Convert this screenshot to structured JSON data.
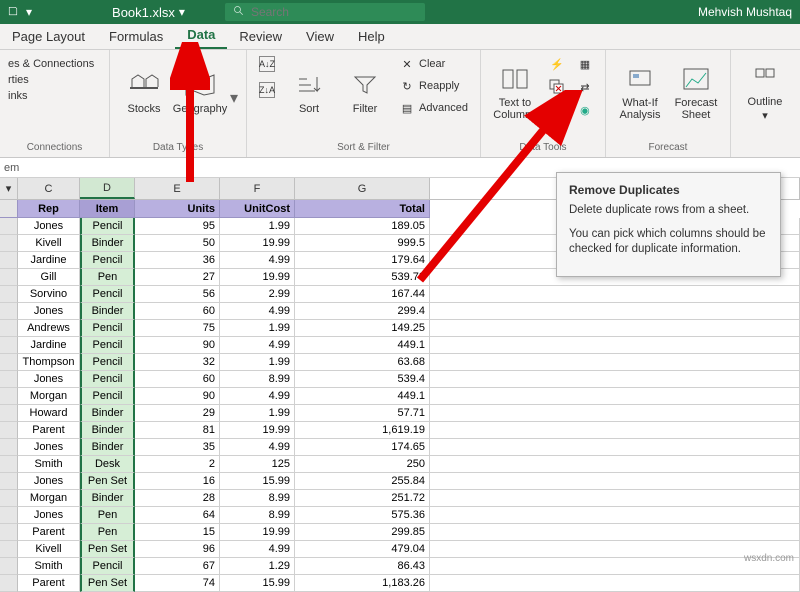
{
  "titlebar": {
    "filename": "Book1.xlsx",
    "search_placeholder": "Search",
    "username": "Mehvish Mushtaq"
  },
  "menu": {
    "tabs": [
      "Page Layout",
      "Formulas",
      "Data",
      "Review",
      "View",
      "Help"
    ],
    "active": "Data"
  },
  "ribbon": {
    "queries": {
      "items": [
        "es & Connections",
        "rties",
        "inks"
      ],
      "label": "Connections"
    },
    "datatypes": {
      "stocks": "Stocks",
      "geography": "Geography",
      "label": "Data Types"
    },
    "sortfilter": {
      "sort": "Sort",
      "filter": "Filter",
      "clear": "Clear",
      "reapply": "Reapply",
      "advanced": "Advanced",
      "label": "Sort & Filter"
    },
    "datatools": {
      "texttocols": "Text to\nColumns",
      "label": "Data Tools"
    },
    "forecast": {
      "whatif": "What-If\nAnalysis",
      "forecast": "Forecast\nSheet",
      "label": "Forecast"
    },
    "outline": {
      "outline": "Outline"
    }
  },
  "formulabar": {
    "ref": "em"
  },
  "cols": {
    "c": "C",
    "d": "D",
    "e": "E",
    "f": "F",
    "g": "G"
  },
  "headers": {
    "rep": "Rep",
    "item": "Item",
    "units": "Units",
    "unitcost": "UnitCost",
    "total": "Total"
  },
  "rows": [
    {
      "rep": "Jones",
      "item": "Pencil",
      "units": "95",
      "cost": "1.99",
      "total": "189.05"
    },
    {
      "rep": "Kivell",
      "item": "Binder",
      "units": "50",
      "cost": "19.99",
      "total": "999.5"
    },
    {
      "rep": "Jardine",
      "item": "Pencil",
      "units": "36",
      "cost": "4.99",
      "total": "179.64"
    },
    {
      "rep": "Gill",
      "item": "Pen",
      "units": "27",
      "cost": "19.99",
      "total": "539.73"
    },
    {
      "rep": "Sorvino",
      "item": "Pencil",
      "units": "56",
      "cost": "2.99",
      "total": "167.44"
    },
    {
      "rep": "Jones",
      "item": "Binder",
      "units": "60",
      "cost": "4.99",
      "total": "299.4"
    },
    {
      "rep": "Andrews",
      "item": "Pencil",
      "units": "75",
      "cost": "1.99",
      "total": "149.25"
    },
    {
      "rep": "Jardine",
      "item": "Pencil",
      "units": "90",
      "cost": "4.99",
      "total": "449.1"
    },
    {
      "rep": "Thompson",
      "item": "Pencil",
      "units": "32",
      "cost": "1.99",
      "total": "63.68"
    },
    {
      "rep": "Jones",
      "item": "Pencil",
      "units": "60",
      "cost": "8.99",
      "total": "539.4"
    },
    {
      "rep": "Morgan",
      "item": "Pencil",
      "units": "90",
      "cost": "4.99",
      "total": "449.1"
    },
    {
      "rep": "Howard",
      "item": "Binder",
      "units": "29",
      "cost": "1.99",
      "total": "57.71"
    },
    {
      "rep": "Parent",
      "item": "Binder",
      "units": "81",
      "cost": "19.99",
      "total": "1,619.19"
    },
    {
      "rep": "Jones",
      "item": "Binder",
      "units": "35",
      "cost": "4.99",
      "total": "174.65"
    },
    {
      "rep": "Smith",
      "item": "Desk",
      "units": "2",
      "cost": "125",
      "total": "250"
    },
    {
      "rep": "Jones",
      "item": "Pen Set",
      "units": "16",
      "cost": "15.99",
      "total": "255.84"
    },
    {
      "rep": "Morgan",
      "item": "Binder",
      "units": "28",
      "cost": "8.99",
      "total": "251.72"
    },
    {
      "rep": "Jones",
      "item": "Pen",
      "units": "64",
      "cost": "8.99",
      "total": "575.36"
    },
    {
      "rep": "Parent",
      "item": "Pen",
      "units": "15",
      "cost": "19.99",
      "total": "299.85"
    },
    {
      "rep": "Kivell",
      "item": "Pen Set",
      "units": "96",
      "cost": "4.99",
      "total": "479.04"
    },
    {
      "rep": "Smith",
      "item": "Pencil",
      "units": "67",
      "cost": "1.29",
      "total": "86.43"
    },
    {
      "rep": "Parent",
      "item": "Pen Set",
      "units": "74",
      "cost": "15.99",
      "total": "1,183.26"
    }
  ],
  "tooltip": {
    "title": "Remove Duplicates",
    "line1": "Delete duplicate rows from a sheet.",
    "line2": "You can pick which columns should be checked for duplicate information."
  },
  "watermark": "wsxdn.com"
}
